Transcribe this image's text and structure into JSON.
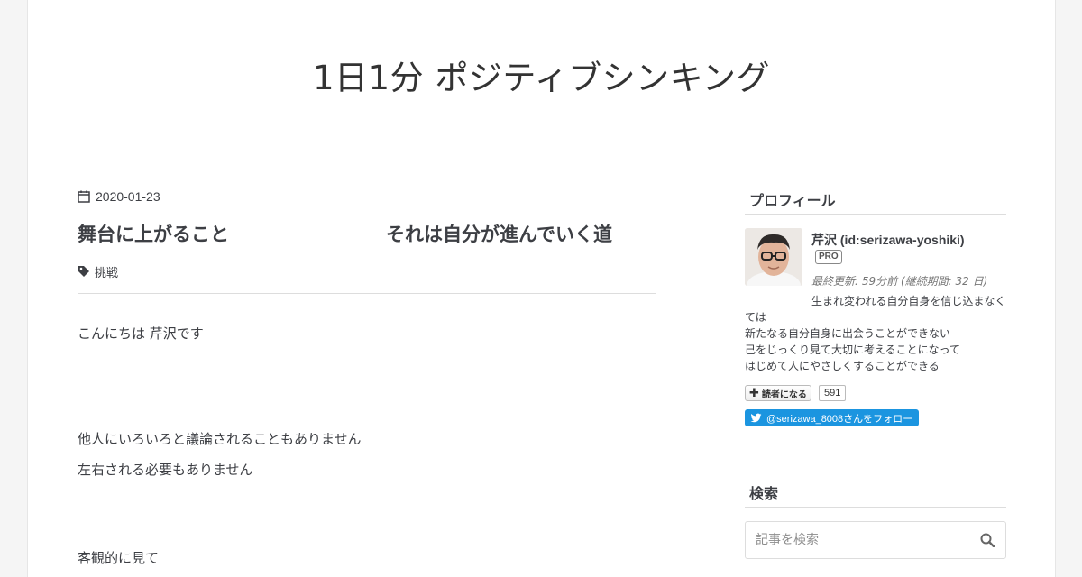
{
  "blog": {
    "title": "1日1分 ポジティブシンキング"
  },
  "entry": {
    "date": "2020-01-23",
    "title_part1": "舞台に上がること",
    "title_part2": "それは自分が進んでいく道",
    "category": "挑戦",
    "paragraphs": [
      "こんにちは 芹沢です",
      "他人にいろいろと議論されることもありません",
      "左右される必要もありません",
      "客観的に見て"
    ]
  },
  "sidebar": {
    "profile": {
      "heading": "プロフィール",
      "name": "芹沢 (id:serizawa-yoshiki)",
      "badge": "PRO",
      "last_update": "最終更新: 59分前 (継続期間: 32 日)",
      "description": [
        "生まれ変われる自分自身を信じ込まなく",
        "ては",
        "新たなる自分自身に出会うことができない",
        "己をじっくり見て大切に考えることになって",
        "はじめて人にやさしくすることができる"
      ],
      "reader_button": "読者になる",
      "reader_count": "591",
      "twitter_follow": "@serizawa_8008さんをフォロー"
    },
    "search": {
      "heading": "検索",
      "placeholder": "記事を検索"
    }
  },
  "colors": {
    "twitter": "#1b95e0",
    "text": "#3d3f44",
    "divider": "#dddddd"
  }
}
